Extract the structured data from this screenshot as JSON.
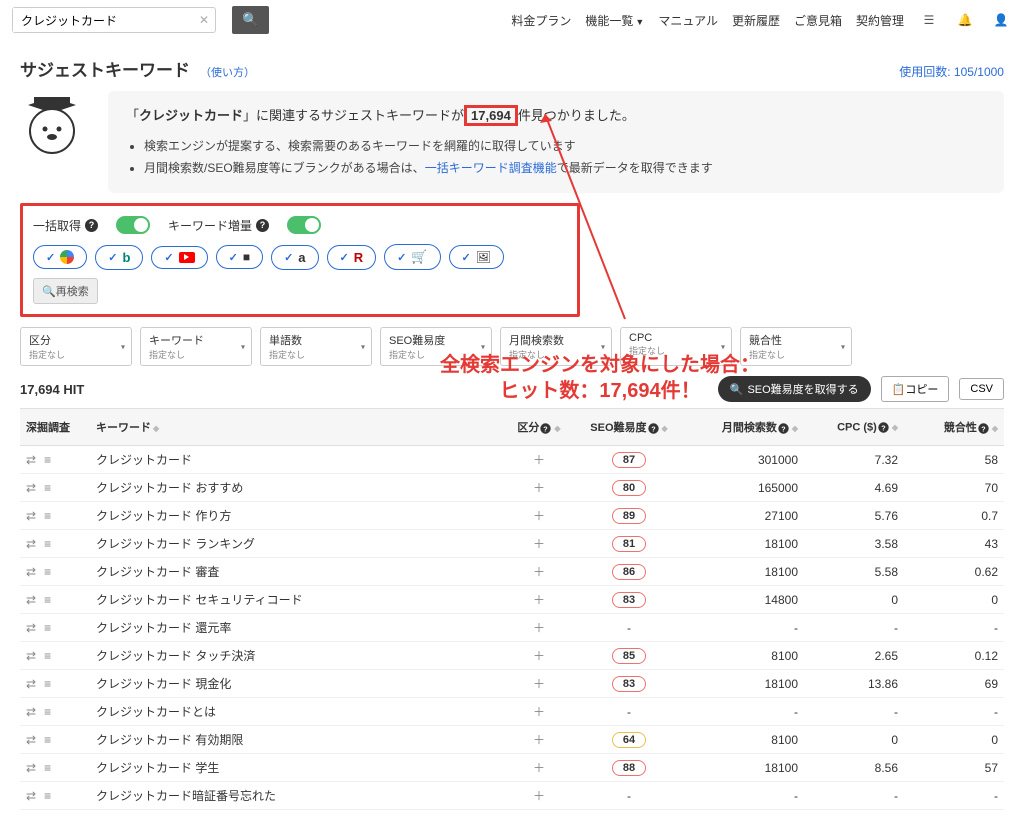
{
  "header": {
    "search_value": "クレジットカード",
    "nav": [
      "料金プラン",
      "機能一覧",
      "マニュアル",
      "更新履歴",
      "ご意見箱",
      "契約管理"
    ]
  },
  "page": {
    "title": "サジェストキーワード",
    "usage_link": "（使い方）",
    "usage_count": "使用回数: 105/1000"
  },
  "intro": {
    "prefix": "「",
    "keyword": "クレジットカード",
    "middle": "」に関連するサジェストキーワードが",
    "count": "17,694",
    "suffix": "件見つかりました。",
    "bullet1": "検索エンジンが提案する、検索需要のあるキーワードを網羅的に取得しています",
    "bullet2a": "月間検索数/SEO難易度等にブランクがある場合は、",
    "bullet2_link": "一括キーワード調査機能",
    "bullet2b": "で最新データを取得できます"
  },
  "toggles": {
    "bulk": "一括取得",
    "boost": "キーワード増量"
  },
  "re_search": "再検索",
  "filters": [
    {
      "label": "区分",
      "value": "指定なし"
    },
    {
      "label": "キーワード",
      "value": "指定なし"
    },
    {
      "label": "単語数",
      "value": "指定なし"
    },
    {
      "label": "SEO難易度",
      "value": "指定なし"
    },
    {
      "label": "月間検索数",
      "value": "指定なし"
    },
    {
      "label": "CPC",
      "value": "指定なし"
    },
    {
      "label": "競合性",
      "value": "指定なし"
    }
  ],
  "hits": "17,694 HIT",
  "actions": {
    "get_seo": "SEO難易度を取得する",
    "copy": "コピー",
    "csv": "CSV"
  },
  "annotation": {
    "line1": "全検索エンジンを対象にした場合：",
    "line2": "ヒット数：17,694件！"
  },
  "table": {
    "headers": {
      "dig": "深掘調査",
      "keyword": "キーワード",
      "kubun": "区分",
      "seo": "SEO難易度",
      "monthly": "月間検索数",
      "cpc": "CPC ($)",
      "comp": "競合性"
    },
    "rows": [
      {
        "kw": "クレジットカード",
        "seo": "87",
        "seoClass": "",
        "m": "301000",
        "cpc": "7.32",
        "c": "58"
      },
      {
        "kw": "クレジットカード おすすめ",
        "seo": "80",
        "seoClass": "",
        "m": "165000",
        "cpc": "4.69",
        "c": "70"
      },
      {
        "kw": "クレジットカード 作り方",
        "seo": "89",
        "seoClass": "",
        "m": "27100",
        "cpc": "5.76",
        "c": "0.7"
      },
      {
        "kw": "クレジットカード ランキング",
        "seo": "81",
        "seoClass": "",
        "m": "18100",
        "cpc": "3.58",
        "c": "43"
      },
      {
        "kw": "クレジットカード 審査",
        "seo": "86",
        "seoClass": "",
        "m": "18100",
        "cpc": "5.58",
        "c": "0.62"
      },
      {
        "kw": "クレジットカード セキュリティコード",
        "seo": "83",
        "seoClass": "",
        "m": "14800",
        "cpc": "0",
        "c": "0"
      },
      {
        "kw": "クレジットカード 還元率",
        "seo": "",
        "seoClass": "",
        "m": "-",
        "cpc": "-",
        "c": "-"
      },
      {
        "kw": "クレジットカード タッチ決済",
        "seo": "85",
        "seoClass": "",
        "m": "8100",
        "cpc": "2.65",
        "c": "0.12"
      },
      {
        "kw": "クレジットカード 現金化",
        "seo": "83",
        "seoClass": "",
        "m": "18100",
        "cpc": "13.86",
        "c": "69"
      },
      {
        "kw": "クレジットカードとは",
        "seo": "",
        "seoClass": "",
        "m": "-",
        "cpc": "-",
        "c": "-"
      },
      {
        "kw": "クレジットカード 有効期限",
        "seo": "64",
        "seoClass": "yellow",
        "m": "8100",
        "cpc": "0",
        "c": "0"
      },
      {
        "kw": "クレジットカード 学生",
        "seo": "88",
        "seoClass": "",
        "m": "18100",
        "cpc": "8.56",
        "c": "57"
      },
      {
        "kw": "クレジットカード暗証番号忘れた",
        "seo": "",
        "seoClass": "",
        "m": "-",
        "cpc": "-",
        "c": "-"
      }
    ]
  }
}
